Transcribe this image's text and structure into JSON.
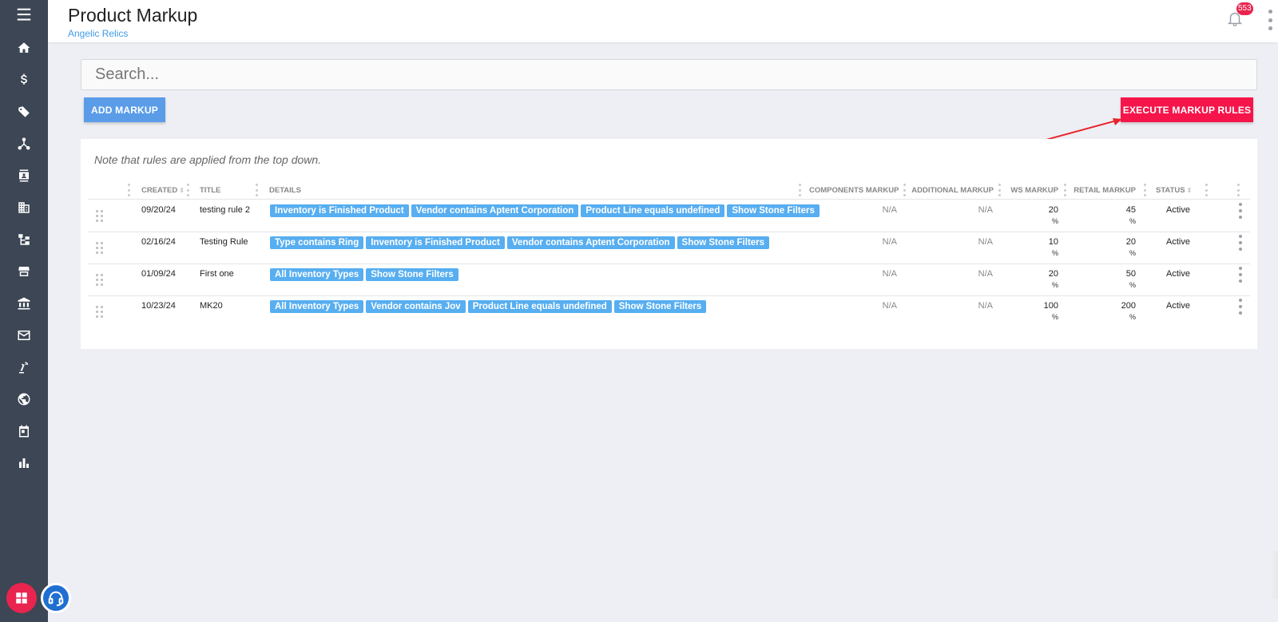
{
  "app": {
    "page_title": "Product Markup",
    "company_link": "Angelic Relics",
    "notification_count": "553"
  },
  "sidebar": {
    "items": [
      {
        "icon": "menu-icon"
      },
      {
        "icon": "home-icon"
      },
      {
        "icon": "dollar-icon"
      },
      {
        "icon": "tags-icon"
      },
      {
        "icon": "network-icon"
      },
      {
        "icon": "contacts-icon"
      },
      {
        "icon": "building-icon"
      },
      {
        "icon": "hierarchy-icon"
      },
      {
        "icon": "store-icon"
      },
      {
        "icon": "bank-icon"
      },
      {
        "icon": "mail-icon"
      },
      {
        "icon": "tools-icon"
      },
      {
        "icon": "globe-icon"
      },
      {
        "icon": "calendar-icon"
      },
      {
        "icon": "bar-chart-icon"
      }
    ]
  },
  "search": {
    "placeholder": "Search...",
    "value": ""
  },
  "buttons": {
    "add_markup": "ADD MARKUP",
    "execute_rules": "EXECUTE MARKUP RULES"
  },
  "colors": {
    "accent_blue": "#5a9ce8",
    "execute_red": "#f5154a",
    "tag_blue": "#57aef0",
    "sidebar_bg": "#3c4654"
  },
  "table": {
    "note": "Note that rules are applied from the top down.",
    "columns": {
      "created": "CREATED",
      "title": "TITLE",
      "details": "DETAILS",
      "components_markup": "COMPONENTS MARKUP",
      "additional_markup": "ADDITIONAL MARKUP",
      "ws_markup": "WS MARKUP",
      "retail_markup": "RETAIL MARKUP",
      "status": "STATUS"
    },
    "rows": [
      {
        "created": "09/20/24",
        "title": "testing rule 2",
        "tags": [
          "Inventory is Finished Product",
          "Vendor contains Aptent Corporation",
          "Product Line equals undefined",
          "Show Stone Filters"
        ],
        "components_markup": "N/A",
        "additional_markup": "N/A",
        "ws_markup": "20",
        "ws_unit": "%",
        "retail_markup": "45",
        "retail_unit": "%",
        "status": "Active"
      },
      {
        "created": "02/16/24",
        "title": "Testing Rule",
        "tags": [
          "Type contains Ring",
          "Inventory is Finished Product",
          "Vendor contains Aptent Corporation",
          "Show Stone Filters"
        ],
        "components_markup": "N/A",
        "additional_markup": "N/A",
        "ws_markup": "10",
        "ws_unit": "%",
        "retail_markup": "20",
        "retail_unit": "%",
        "status": "Active"
      },
      {
        "created": "01/09/24",
        "title": "First one",
        "tags": [
          "All Inventory Types",
          "Show Stone Filters"
        ],
        "components_markup": "N/A",
        "additional_markup": "N/A",
        "ws_markup": "20",
        "ws_unit": "%",
        "retail_markup": "50",
        "retail_unit": "%",
        "status": "Active"
      },
      {
        "created": "10/23/24",
        "title": "MK20",
        "tags": [
          "All Inventory Types",
          "Vendor contains Jov",
          "Product Line equals undefined",
          "Show Stone Filters"
        ],
        "components_markup": "N/A",
        "additional_markup": "N/A",
        "ws_markup": "100",
        "ws_unit": "%",
        "retail_markup": "200",
        "retail_unit": "%",
        "status": "Active"
      }
    ]
  }
}
